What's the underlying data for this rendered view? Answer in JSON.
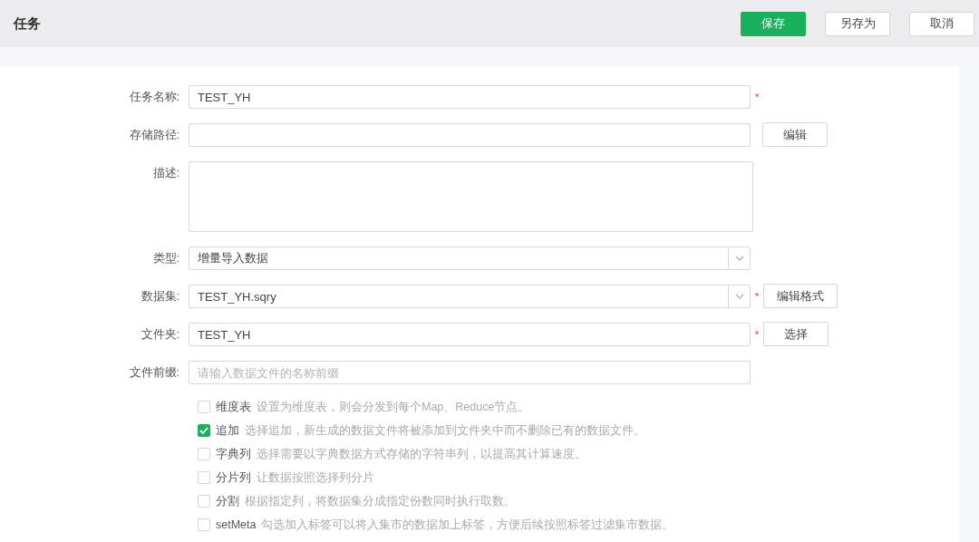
{
  "header": {
    "title": "任务",
    "buttons": [
      {
        "label": "保存",
        "kind": "primary"
      },
      {
        "label": "另存为",
        "kind": "default"
      },
      {
        "label": "取消",
        "kind": "default"
      }
    ]
  },
  "fields": [
    {
      "label": "任务名称:",
      "kind": "text",
      "value": "TEST_YH",
      "required_mark": "*"
    },
    {
      "label": "存储路径:",
      "kind": "text",
      "button": "编辑"
    },
    {
      "label": "描述:",
      "kind": "textarea"
    },
    {
      "label": "类型:",
      "kind": "select",
      "value": "增量导入数据"
    },
    {
      "label": "数据集:",
      "kind": "select",
      "value": "TEST_YH.sqry",
      "required_mark": "*",
      "button": "编辑格式"
    },
    {
      "label": "文件夹:",
      "kind": "text",
      "value": "TEST_YH",
      "required_mark": "*",
      "button": "选择"
    },
    {
      "label": "文件前缀:",
      "kind": "text",
      "placeholder": "请输入数据文件的名称前缀"
    }
  ],
  "options": [
    {
      "label": "维度表",
      "hint": "设置为维度表，则会分发到每个Map、Reduce节点。",
      "checked": false
    },
    {
      "label": "追加",
      "hint": "选择追加，新生成的数据文件将被添加到文件夹中而不删除已有的数据文件。",
      "checked": true
    },
    {
      "label": "字典列",
      "hint": "选择需要以字典数据方式存储的字符串列，以提高其计算速度。",
      "checked": false
    },
    {
      "label": "分片列",
      "hint": "让数据按照选择列分片",
      "checked": false
    },
    {
      "label": "分割",
      "hint": "根据指定列，将数据集分成指定份数同时执行取数。",
      "checked": false
    },
    {
      "label": "setMeta",
      "hint": "勾选加入标签可以将入集市的数据加上标签，方便后续按照标签过滤集市数据。",
      "checked": false
    }
  ]
}
